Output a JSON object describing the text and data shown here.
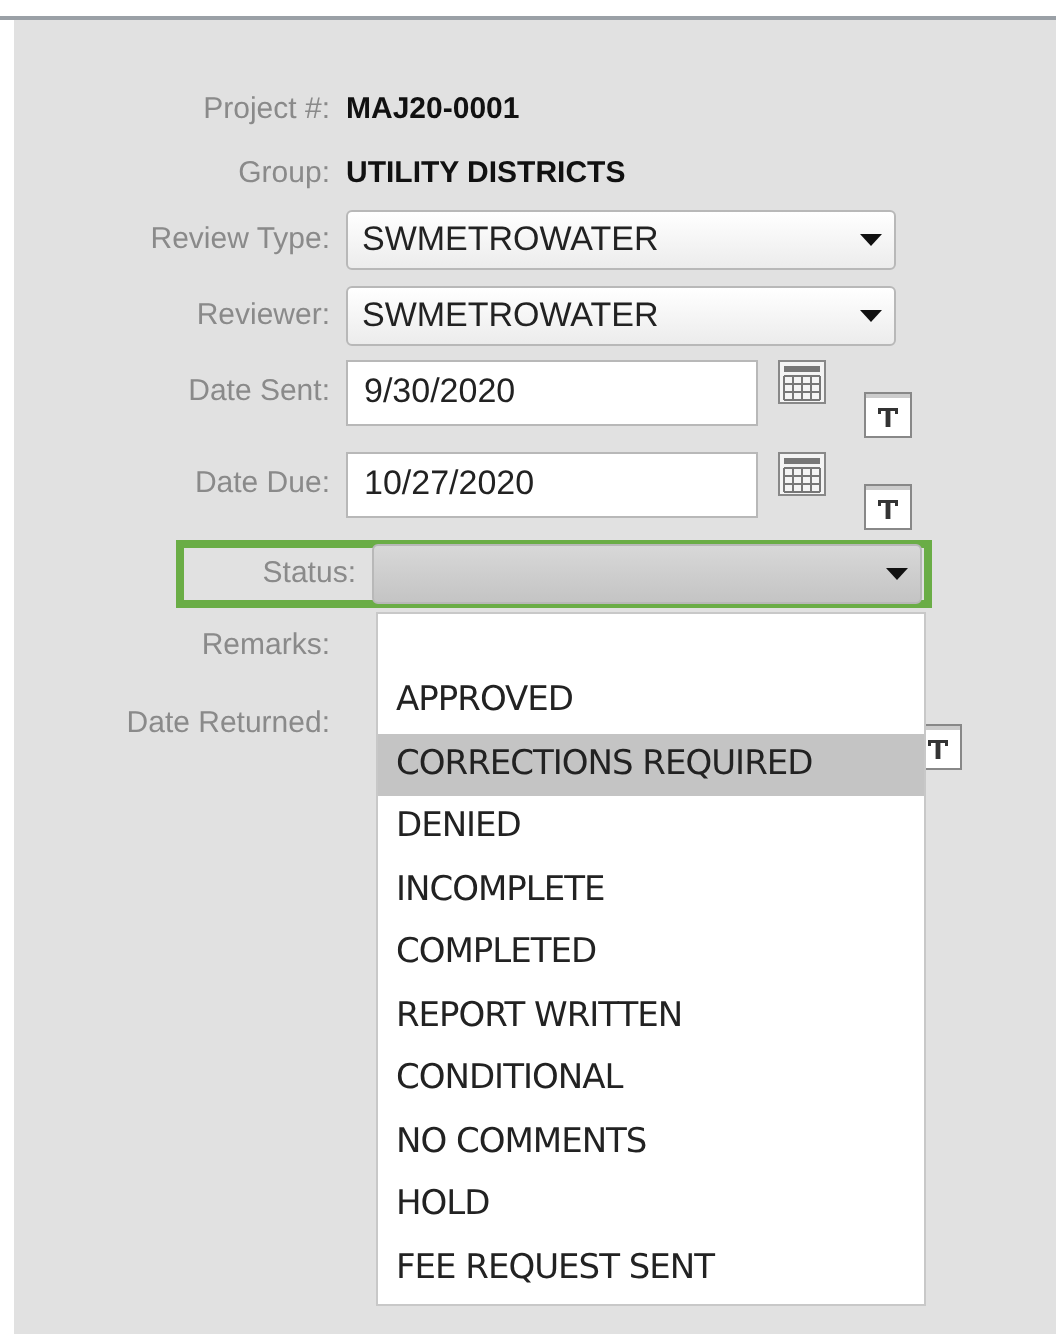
{
  "fields": [
    {
      "kind": "text",
      "label": "Project #:",
      "value": "MAJ20-0001"
    },
    {
      "kind": "text",
      "label": "Group:",
      "value": "UTILITY DISTRICTS"
    },
    {
      "kind": "select",
      "label": "Review Type:",
      "value": "SWMETROWATER"
    },
    {
      "kind": "select",
      "label": "Reviewer:",
      "value": "SWMETROWATER"
    },
    {
      "kind": "date",
      "label": "Date Sent:",
      "value": "9/30/2020"
    },
    {
      "kind": "date",
      "label": "Date Due:",
      "value": "10/27/2020"
    },
    {
      "kind": "select",
      "label": "Status:",
      "highlighted": true,
      "expanded": true
    },
    {
      "kind": "textarea",
      "label": "Remarks:"
    },
    {
      "kind": "date",
      "label": "Date Returned:"
    }
  ],
  "status_options": [
    {
      "label": "APPROVED",
      "selected": false
    },
    {
      "label": "CORRECTIONS REQUIRED",
      "selected": true
    },
    {
      "label": "DENIED",
      "selected": false
    },
    {
      "label": "INCOMPLETE",
      "selected": false
    },
    {
      "label": "COMPLETED",
      "selected": false
    },
    {
      "label": "REPORT WRITTEN",
      "selected": false
    },
    {
      "label": "CONDITIONAL",
      "selected": false
    },
    {
      "label": "NO COMMENTS",
      "selected": false
    },
    {
      "label": "HOLD",
      "selected": false
    },
    {
      "label": "FEE REQUEST SENT",
      "selected": false
    }
  ]
}
